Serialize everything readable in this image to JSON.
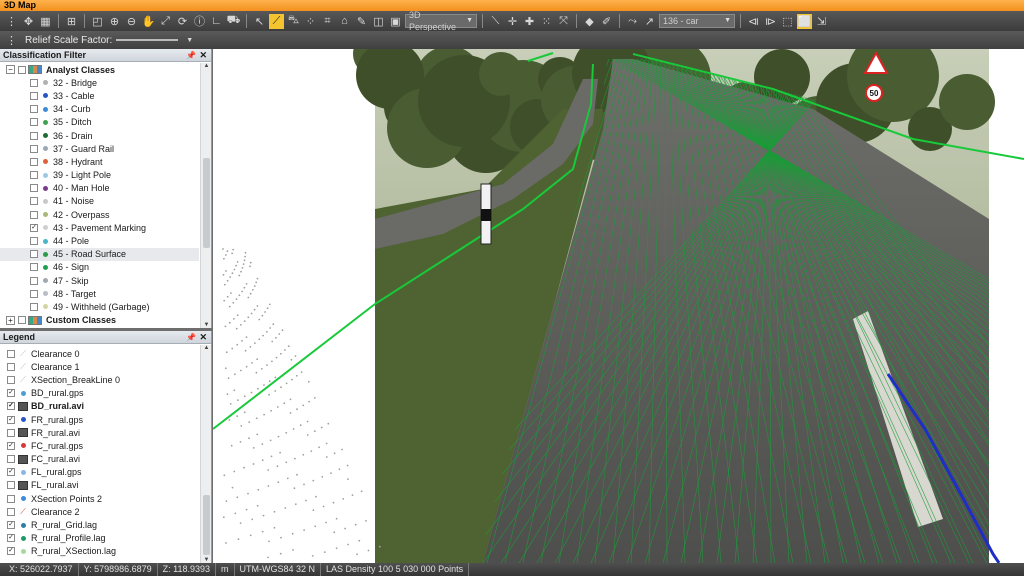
{
  "window": {
    "title": "3D Map"
  },
  "toolbar": {
    "view_mode": "3D Perspective",
    "camera": "136 - car",
    "relief_label": "Relief Scale Factor:"
  },
  "classification": {
    "title": "Classification Filter",
    "group_analyst": "Analyst Classes",
    "group_custom": "Custom Classes",
    "items": [
      {
        "label": "32 - Bridge",
        "color": "#b0b0b0",
        "checked": false
      },
      {
        "label": "33 - Cable",
        "color": "#2a55c8",
        "checked": false
      },
      {
        "label": "34 - Curb",
        "color": "#3d8bd9",
        "checked": false
      },
      {
        "label": "35 - Ditch",
        "color": "#3fa34d",
        "checked": false
      },
      {
        "label": "36 - Drain",
        "color": "#1e6b34",
        "checked": false
      },
      {
        "label": "37 - Guard Rail",
        "color": "#9aa9b8",
        "checked": false
      },
      {
        "label": "38 - Hydrant",
        "color": "#e0603a",
        "checked": false
      },
      {
        "label": "39 - Light Pole",
        "color": "#9cc9e8",
        "checked": false
      },
      {
        "label": "40 - Man Hole",
        "color": "#7a3a8a",
        "checked": false
      },
      {
        "label": "41 - Noise",
        "color": "#c8c8c8",
        "checked": false
      },
      {
        "label": "42 - Overpass",
        "color": "#a8b878",
        "checked": false
      },
      {
        "label": "43 - Pavement Marking",
        "color": "#cfcfcf",
        "checked": true
      },
      {
        "label": "44 - Pole",
        "color": "#46b5c8",
        "checked": false
      },
      {
        "label": "45 - Road Surface",
        "color": "#2e9b4a",
        "checked": false
      },
      {
        "label": "46 - Sign",
        "color": "#21a055",
        "checked": false
      },
      {
        "label": "47 - Skip",
        "color": "#a0a8b0",
        "checked": false
      },
      {
        "label": "48 - Target",
        "color": "#b8bec4",
        "checked": false
      },
      {
        "label": "49 - Withheld (Garbage)",
        "color": "#d2d6a0",
        "checked": false
      }
    ]
  },
  "legend": {
    "title": "Legend",
    "items": [
      {
        "label": "Clearance 0",
        "icon": "line",
        "color": "#bbbbbb",
        "checked": false,
        "bold": false
      },
      {
        "label": "Clearance 1",
        "icon": "line",
        "color": "#bbbbbb",
        "checked": false,
        "bold": false
      },
      {
        "label": "XSection_BreakLine 0",
        "icon": "line",
        "color": "#bbbbbb",
        "checked": false,
        "bold": false
      },
      {
        "label": "BD_rural.gps",
        "icon": "dot",
        "color": "#4a9fd8",
        "checked": true,
        "bold": false
      },
      {
        "label": "BD_rural.avi",
        "icon": "video",
        "color": "#555555",
        "checked": true,
        "bold": true
      },
      {
        "label": "FR_rural.gps",
        "icon": "dot",
        "color": "#2a55c8",
        "checked": true,
        "bold": false
      },
      {
        "label": "FR_rural.avi",
        "icon": "video",
        "color": "#555555",
        "checked": false,
        "bold": false
      },
      {
        "label": "FC_rural.gps",
        "icon": "dot",
        "color": "#d83a3a",
        "checked": true,
        "bold": false
      },
      {
        "label": "FC_rural.avi",
        "icon": "video",
        "color": "#555555",
        "checked": false,
        "bold": false
      },
      {
        "label": "FL_rural.gps",
        "icon": "dot",
        "color": "#8ab8e0",
        "checked": true,
        "bold": false
      },
      {
        "label": "FL_rural.avi",
        "icon": "video",
        "color": "#555555",
        "checked": false,
        "bold": false
      },
      {
        "label": "XSection Points 2",
        "icon": "dot",
        "color": "#3d8bd9",
        "checked": false,
        "bold": false
      },
      {
        "label": "Clearance 2",
        "icon": "line",
        "color": "#d83a3a",
        "checked": false,
        "bold": false
      },
      {
        "label": "R_rural_Grid.lag",
        "icon": "dot",
        "color": "#2e7ea8",
        "checked": true,
        "bold": false
      },
      {
        "label": "R_rural_Profile.lag",
        "icon": "dot",
        "color": "#1e9b6a",
        "checked": true,
        "bold": false
      },
      {
        "label": "R_rural_XSection.lag",
        "icon": "dot",
        "color": "#a8d8a0",
        "checked": true,
        "bold": false
      }
    ]
  },
  "status": {
    "x": "X: 526022.7937",
    "y": "Y: 5798986.6879",
    "z": "Z: 118.9393",
    "unit": "m",
    "crs": "UTM-WGS84  32 N",
    "las": "LAS Density 100 5 030 000 Points"
  },
  "scene": {
    "sign_speed": "50",
    "colors": {
      "grid": "#1e9b3a",
      "breakline": "#18c93a",
      "gps_track": "#1e2fc8",
      "asphalt": "#5a5a58",
      "grass": "#556b3a"
    }
  }
}
